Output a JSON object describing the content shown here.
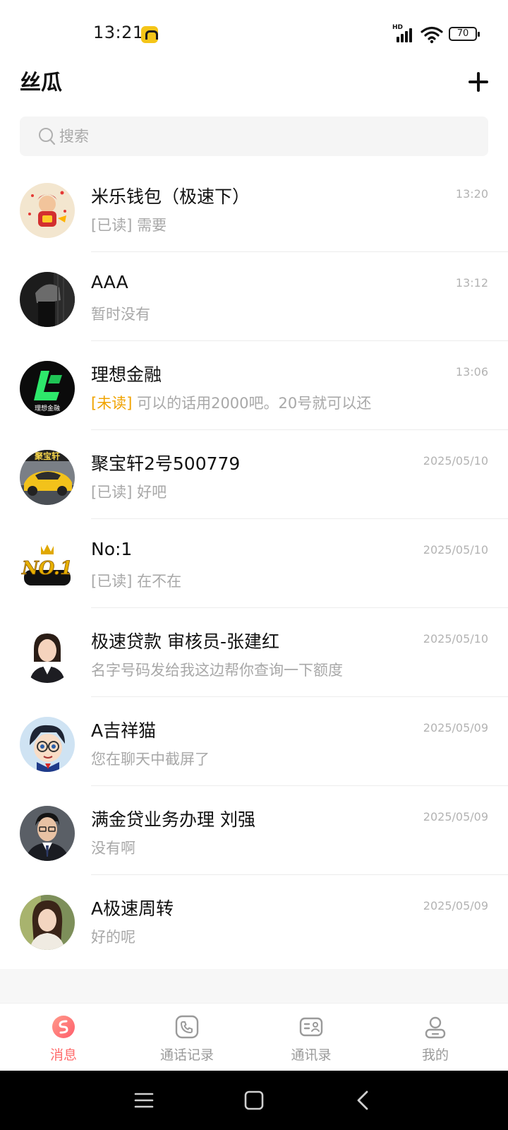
{
  "status_bar": {
    "time": "13:21",
    "signal_label": "HD",
    "battery_level": "70"
  },
  "header": {
    "title": "丝瓜",
    "add_icon": "plus-icon"
  },
  "search": {
    "placeholder": "搜索",
    "icon": "search-icon"
  },
  "conversations": [
    {
      "name": "米乐钱包（极速下）",
      "time": "13:20",
      "tag": "[已读]",
      "message": "需要",
      "tag_color": "#a8a8a8"
    },
    {
      "name": "AAA",
      "time": "13:12",
      "tag": "",
      "message": "暂时没有",
      "tag_color": "#a8a8a8"
    },
    {
      "name": "理想金融",
      "time": "13:06",
      "tag": "[未读]",
      "message": "可以的话用2000吧。20号就可以还",
      "tag_color": "#f0a300",
      "avatar_text": "理想金融"
    },
    {
      "name": "聚宝轩2号500779",
      "time": "2025/05/10",
      "tag": "[已读]",
      "message": "好吧",
      "tag_color": "#a8a8a8",
      "avatar_text": "聚宝轩"
    },
    {
      "name": "No:1",
      "time": "2025/05/10",
      "tag": "[已读]",
      "message": "在不在",
      "tag_color": "#a8a8a8",
      "avatar_text": "NO.1"
    },
    {
      "name": "极速贷款 审核员-张建红",
      "time": "2025/05/10",
      "tag": "",
      "message": "名字号码发给我这边帮你查询一下额度",
      "tag_color": "#a8a8a8"
    },
    {
      "name": "A吉祥猫",
      "time": "2025/05/09",
      "tag": "",
      "message": "您在聊天中截屏了",
      "tag_color": "#a8a8a8"
    },
    {
      "name": "满金贷业务办理 刘强",
      "time": "2025/05/09",
      "tag": "",
      "message": "没有啊",
      "tag_color": "#a8a8a8"
    },
    {
      "name": "A极速周转",
      "time": "2025/05/09",
      "tag": "",
      "message": "好的呢",
      "tag_color": "#a8a8a8"
    }
  ],
  "tabs": [
    {
      "label": "消息",
      "icon": "message-icon",
      "active": true
    },
    {
      "label": "通话记录",
      "icon": "call-log-icon",
      "active": false
    },
    {
      "label": "通讯录",
      "icon": "contacts-icon",
      "active": false
    },
    {
      "label": "我的",
      "icon": "profile-icon",
      "active": false
    }
  ],
  "colors": {
    "accent": "#ff6b6b",
    "unread": "#f0a300",
    "muted": "#a8a8a8"
  }
}
